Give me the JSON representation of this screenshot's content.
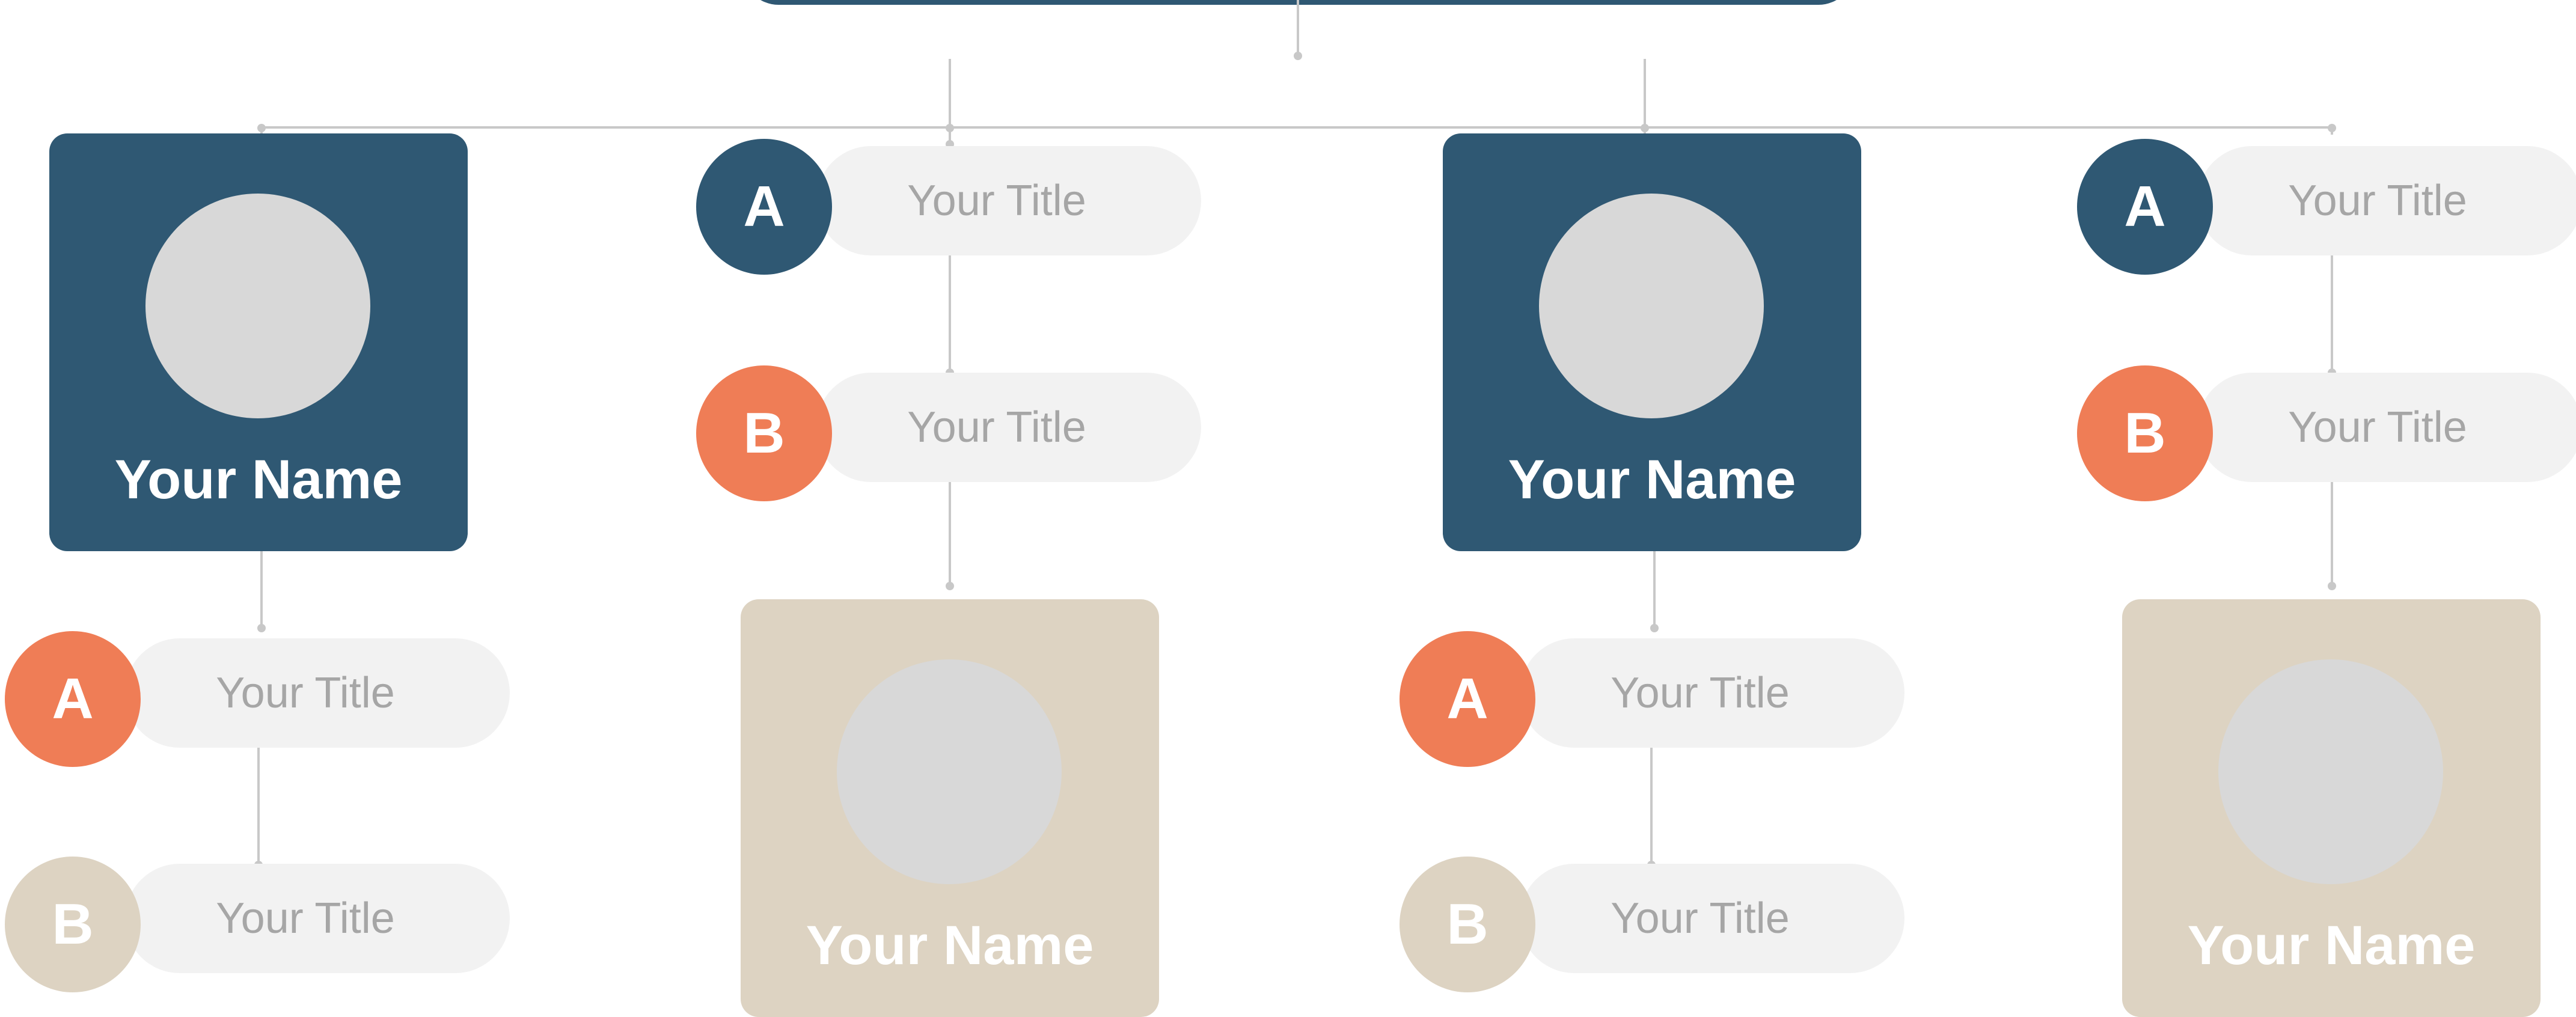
{
  "colors": {
    "navy": "#2f5873",
    "orange": "#ef7d56",
    "beige": "#ddd3c2",
    "avatar": "#d8d8d8",
    "pill": "#f2f2f2",
    "pill_text": "#a6a6a6",
    "connector": "#c8c8c8"
  },
  "nodes": [
    {
      "kind": "card",
      "name": "Your Name",
      "color": "navy"
    },
    {
      "kind": "pill",
      "letter": "A",
      "title": "Your Title",
      "badge_color": "orange"
    },
    {
      "kind": "pill",
      "letter": "B",
      "title": "Your Title",
      "badge_color": "beige"
    },
    {
      "kind": "pill",
      "letter": "A",
      "title": "Your Title",
      "badge_color": "navy"
    },
    {
      "kind": "pill",
      "letter": "B",
      "title": "Your Title",
      "badge_color": "orange"
    },
    {
      "kind": "card",
      "name": "Your Name",
      "color": "beige"
    },
    {
      "kind": "card",
      "name": "Your Name",
      "color": "navy"
    },
    {
      "kind": "pill",
      "letter": "A",
      "title": "Your Title",
      "badge_color": "orange"
    },
    {
      "kind": "pill",
      "letter": "B",
      "title": "Your Title",
      "badge_color": "beige"
    },
    {
      "kind": "pill",
      "letter": "A",
      "title": "Your Title",
      "badge_color": "navy"
    },
    {
      "kind": "pill",
      "letter": "B",
      "title": "Your Title",
      "badge_color": "orange"
    },
    {
      "kind": "card",
      "name": "Your Name",
      "color": "beige"
    }
  ]
}
